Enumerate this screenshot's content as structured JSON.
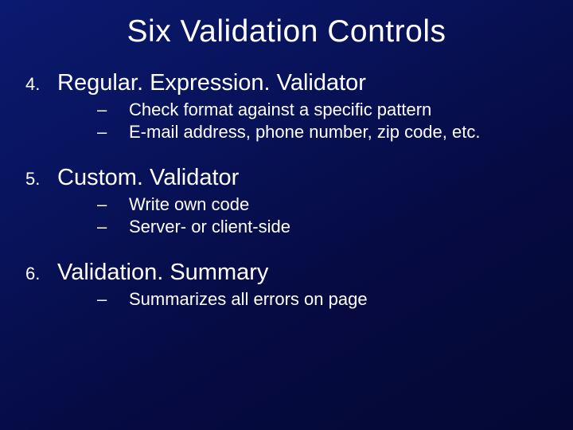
{
  "title": "Six Validation Controls",
  "items": [
    {
      "number": "4.",
      "heading": "Regular. Expression. Validator",
      "subs": [
        "Check format against a specific pattern",
        "E-mail address, phone number, zip code, etc."
      ]
    },
    {
      "number": "5.",
      "heading": "Custom. Validator",
      "subs": [
        "Write own code",
        "Server- or client-side"
      ]
    },
    {
      "number": "6.",
      "heading": "Validation. Summary",
      "subs": [
        "Summarizes all errors on page"
      ]
    }
  ],
  "dash": "–"
}
